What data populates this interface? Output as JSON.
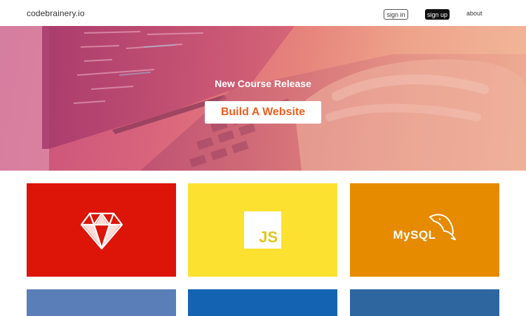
{
  "header": {
    "brand": "codebrainery.io",
    "nav": {
      "sign_in": "sign in",
      "sign_up": "sign up",
      "about": "about"
    }
  },
  "hero": {
    "subtitle": "New Course Release",
    "cta_label": "Build A Website"
  },
  "tiles": [
    {
      "name": "ruby",
      "icon": "ruby-gem-icon",
      "color": "#dd1408"
    },
    {
      "name": "javascript",
      "icon": "js-logo-icon",
      "label": "JS",
      "color": "#fce131"
    },
    {
      "name": "mysql",
      "icon": "mysql-dolphin-icon",
      "label": "MySQL",
      "color": "#e68a00"
    },
    {
      "name": "tile-4",
      "color": "#5a7fb8"
    },
    {
      "name": "tile-5",
      "color": "#1463b3"
    },
    {
      "name": "tile-6",
      "color": "#2e679f"
    }
  ]
}
